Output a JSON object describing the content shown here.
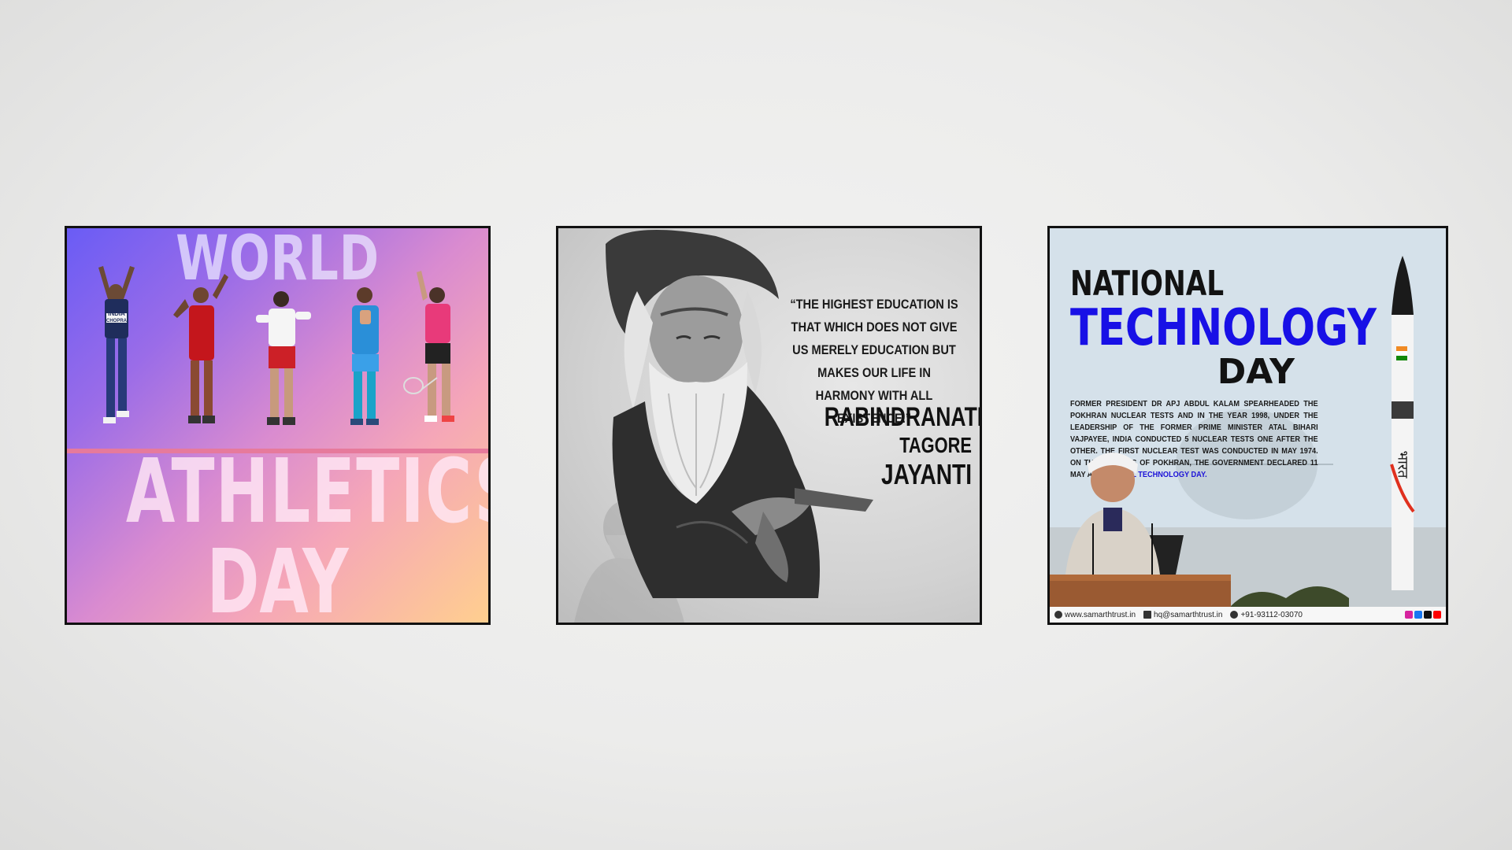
{
  "cards": [
    {
      "title_top": "WORLD",
      "title_mid": "ATHLETICS",
      "title_bottom": "DAY",
      "athlete_bib_text": "INDIA",
      "athlete_bib_name": "CHOPRA"
    },
    {
      "quote": "“THE HIGHEST EDUCATION IS THAT WHICH DOES NOT GIVE US MERELY EDUCATION BUT MAKES OUR LIFE IN HARMONY WITH ALL EXISTENCE.”",
      "name_line1": "RABINDRANATH",
      "name_line2a": "TAGORE",
      "name_line2b": "JAYANTI"
    },
    {
      "title_top": "NATIONAL",
      "title_mid": "TECHNOLOGY",
      "title_bottom": "DAY",
      "description": "FORMER PRESIDENT DR APJ ABDUL KALAM SPEARHEADED THE POKHRAN NUCLEAR TESTS AND IN THE YEAR 1998, UNDER THE LEADERSHIP OF THE FORMER PRIME MINISTER ATAL BIHARI VAJPAYEE, INDIA CONDUCTED 5 NUCLEAR TESTS ONE AFTER THE OTHER. THE FIRST NUCLEAR TEST WAS CONDUCTED IN MAY 1974. ON THE SUCCESS OF POKHRAN, THE GOVERNMENT DECLARED 11 MAY AS",
      "description_highlight": "NATIONAL TECHNOLOGY DAY.",
      "missile_text": "भारत",
      "footer_website": "www.samarthtrust.in",
      "footer_email": "hq@samarthtrust.in",
      "footer_phone": "+91-93112-03070"
    }
  ],
  "colors": {
    "technology_blue": "#1810e6",
    "highlight_blue": "#1c12d8",
    "card_border": "#111111"
  }
}
